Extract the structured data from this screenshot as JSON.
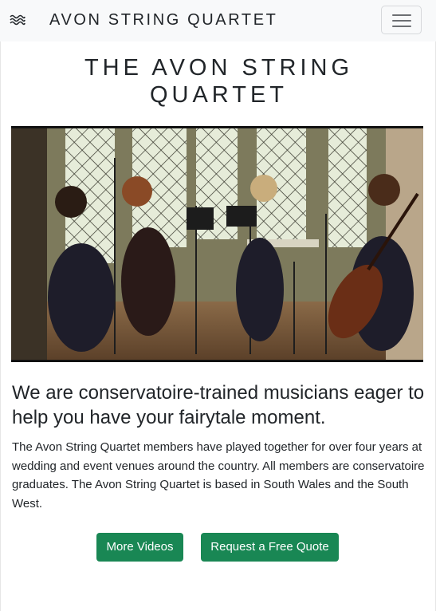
{
  "navbar": {
    "brand_title": "AVON STRING QUARTET",
    "brand_icon": "waves-icon",
    "toggler_icon": "hamburger-menu-icon"
  },
  "main": {
    "page_title_line1": "THE AVON STRING",
    "page_title_line2": "QUARTET",
    "hero_image": "photo of string quartet performing in front of leaded windows",
    "headline": "We are conservatoire-trained musicians eager to help you have your fairytale moment.",
    "paragraph": "The Avon String Quartet members have played together for over four years at wedding and event venues around the country. All members are conservatoire graduates. The Avon String Quartet is based in South Wales and the South West.",
    "buttons": {
      "videos_label": "More Videos",
      "quote_label": "Request a Free Quote"
    }
  },
  "colors": {
    "navbar_bg": "#f8f9fa",
    "button_green": "#198754",
    "text": "#212529"
  }
}
